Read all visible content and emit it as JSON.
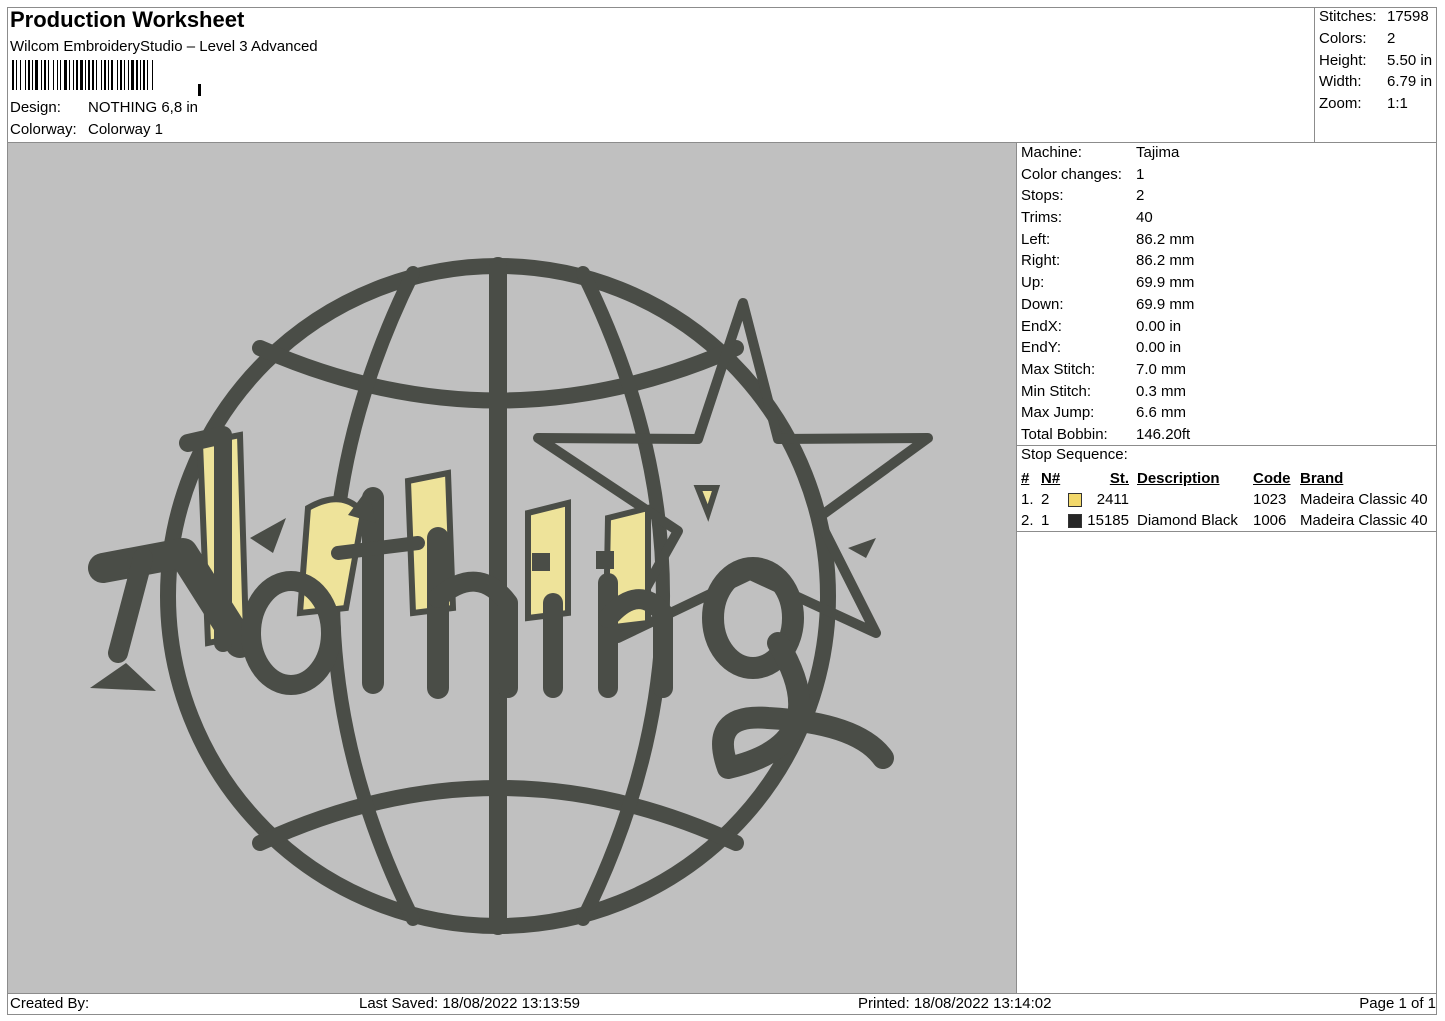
{
  "header": {
    "title": "Production Worksheet",
    "software": "Wilcom EmbroideryStudio – Level 3 Advanced",
    "design_label": "Design:",
    "design_value": "NOTHING 6,8 in",
    "colorway_label": "Colorway:",
    "colorway_value": "Colorway 1"
  },
  "summary": [
    {
      "label": "Stitches:",
      "value": "17598"
    },
    {
      "label": "Colors:",
      "value": "2"
    },
    {
      "label": "Height:",
      "value": "5.50 in"
    },
    {
      "label": "Width:",
      "value": "6.79 in"
    },
    {
      "label": "Zoom:",
      "value": "1:1"
    }
  ],
  "machine_info": [
    {
      "label": "Machine:",
      "value": "Tajima"
    },
    {
      "label": "Color changes:",
      "value": "1"
    },
    {
      "label": "Stops:",
      "value": "2"
    },
    {
      "label": "Trims:",
      "value": "40"
    },
    {
      "label": "Left:",
      "value": "86.2 mm"
    },
    {
      "label": "Right:",
      "value": "86.2 mm"
    },
    {
      "label": "Up:",
      "value": "69.9 mm"
    },
    {
      "label": "Down:",
      "value": "69.9 mm"
    },
    {
      "label": "EndX:",
      "value": "0.00 in"
    },
    {
      "label": "EndY:",
      "value": "0.00 in"
    },
    {
      "label": "Max Stitch:",
      "value": "7.0 mm"
    },
    {
      "label": "Min Stitch:",
      "value": "0.3 mm"
    },
    {
      "label": "Max Jump:",
      "value": "6.6 mm"
    },
    {
      "label": "Total Bobbin:",
      "value": "146.20ft"
    }
  ],
  "stop_sequence": {
    "label": "Stop Sequence:",
    "headers": {
      "num": "#",
      "n": "N#",
      "st": "St.",
      "desc": "Description",
      "code": "Code",
      "brand": "Brand"
    },
    "rows": [
      {
        "num": "1.",
        "n": "2",
        "color": "#f2d86b",
        "st": "2411",
        "desc": "",
        "code": "1023",
        "brand": "Madeira Classic 40"
      },
      {
        "num": "2.",
        "n": "1",
        "color": "#262626",
        "st": "15185",
        "desc": "Diamond Black",
        "code": "1006",
        "brand": "Madeira Classic 40"
      }
    ]
  },
  "design": {
    "background_color": "#c0c0c0",
    "thread_dark": "#4a4d47",
    "thread_yellow": "#eee39a"
  },
  "footer": {
    "created_by": "Created By:",
    "last_saved": "Last Saved: 18/08/2022 13:13:59",
    "printed": "Printed: 18/08/2022 13:14:02",
    "page": "Page 1 of 1"
  }
}
